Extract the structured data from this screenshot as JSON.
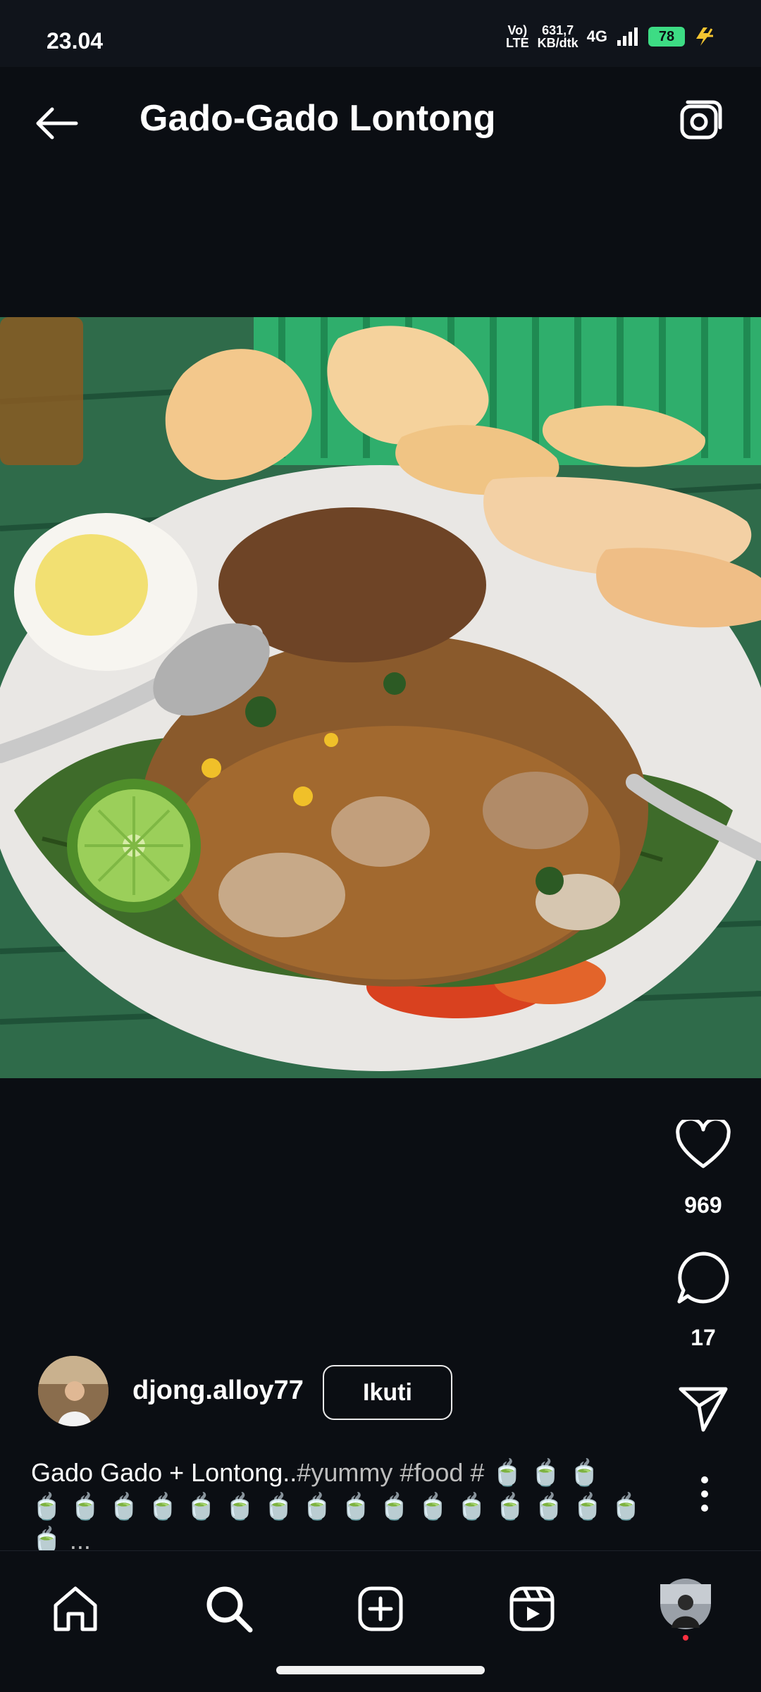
{
  "status_bar": {
    "time": "23.04",
    "volte": "Vo)",
    "lte": "LTE",
    "speed_value": "631,7",
    "speed_unit": "KB/dtk",
    "network": "4G",
    "battery": "78"
  },
  "header": {
    "title": "Gado-Gado Lontong"
  },
  "post": {
    "likes": "969",
    "comments": "17",
    "user": {
      "username": "djong.alloy77",
      "follow_label": "Ikuti"
    },
    "caption": {
      "text": "Gado Gado + Lontong..",
      "tags": "#yummy #food #",
      "ellipsis": "..."
    }
  },
  "icons": {
    "back": "arrow-left-icon",
    "camera": "camera-icon",
    "like": "heart-icon",
    "comment": "comment-bubble-icon",
    "share": "send-icon",
    "more": "more-vertical-icon",
    "home": "home-icon",
    "search": "search-icon",
    "create": "add-square-icon",
    "reels": "reels-icon",
    "profile": "profile-avatar-icon"
  },
  "colors": {
    "background": "#0b0e13",
    "text": "#ffffff",
    "notification_dot": "#ff3040",
    "battery": "#3ddc84"
  }
}
